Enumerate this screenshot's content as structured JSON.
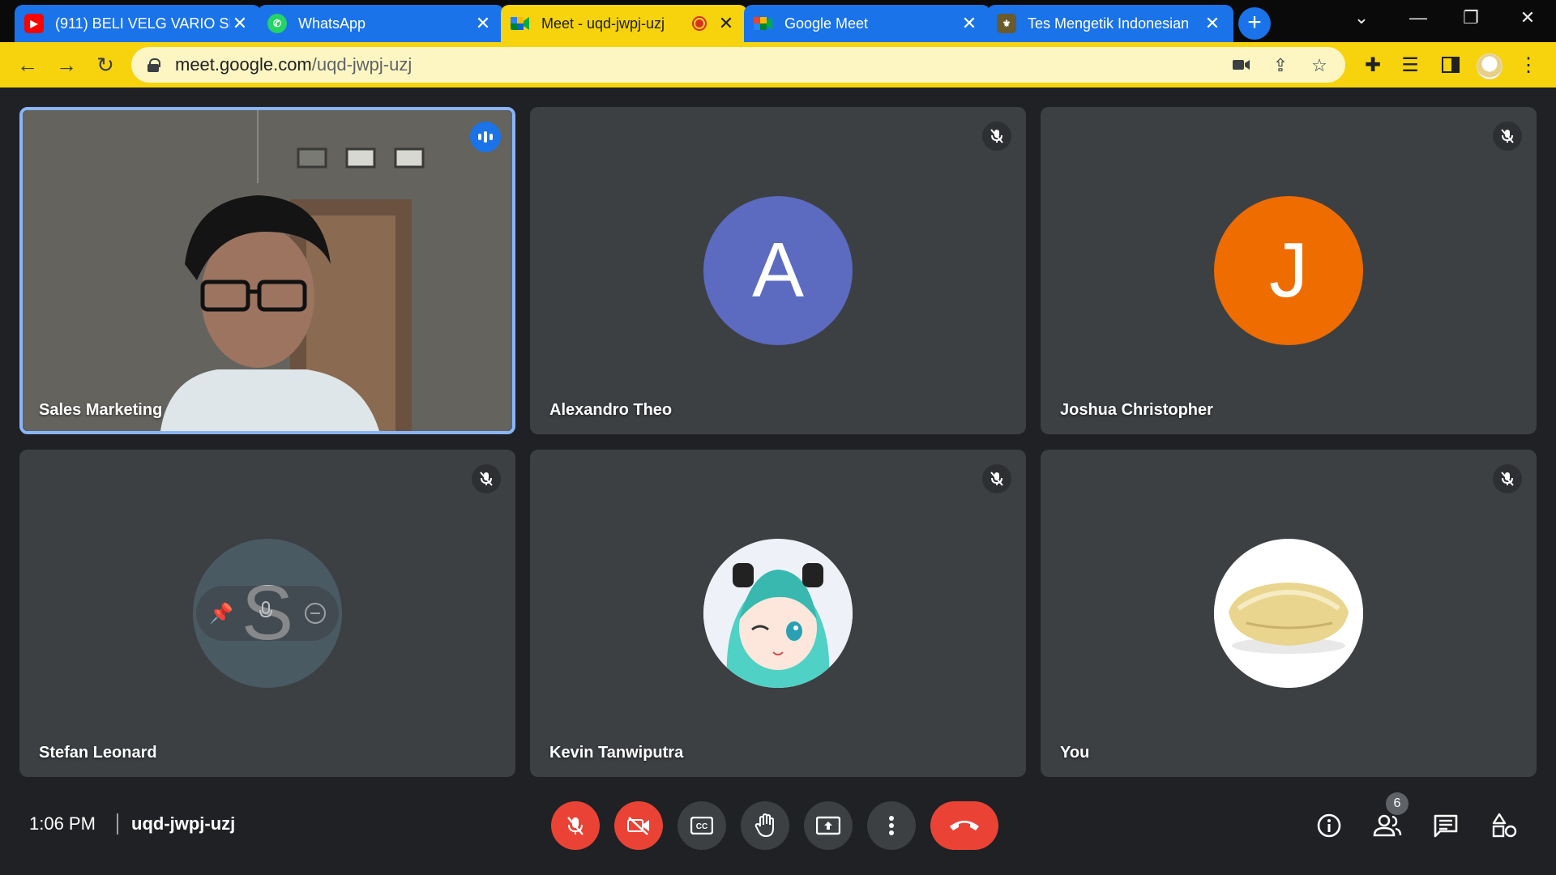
{
  "browser": {
    "tabs": [
      {
        "title": "(911) BELI VELG VARIO SE",
        "favicon": "youtube-icon"
      },
      {
        "title": "WhatsApp",
        "favicon": "whatsapp-icon"
      },
      {
        "title": "Meet - uqd-jwpj-uzj",
        "favicon": "meet-icon",
        "recording": true,
        "active": true
      },
      {
        "title": "Google Meet",
        "favicon": "google-meet-icon"
      },
      {
        "title": "Tes Mengetik Indonesian",
        "favicon": "site-icon"
      }
    ],
    "url_host": "meet.google.com",
    "url_path": "/uqd-jwpj-uzj",
    "theme_color": "#f6d30c",
    "tab_color": "#1a73e8"
  },
  "participants": [
    {
      "name": "Sales Marketing",
      "type": "video",
      "speaking": true
    },
    {
      "name": "Alexandro Theo",
      "initial": "A",
      "avatar_color": "#5c6bc0"
    },
    {
      "name": "Joshua Christopher",
      "initial": "J",
      "avatar_color": "#ef6c00"
    },
    {
      "name": "Stefan Leonard",
      "initial": "S",
      "avatar_color": "#4a5a63"
    },
    {
      "name": "Kevin Tanwiputra",
      "type": "image-avatar"
    },
    {
      "name": "You",
      "type": "image-avatar"
    }
  ],
  "bottom_bar": {
    "time": "1:06 PM",
    "meeting_code": "uqd-jwpj-uzj",
    "participant_count": "6"
  }
}
